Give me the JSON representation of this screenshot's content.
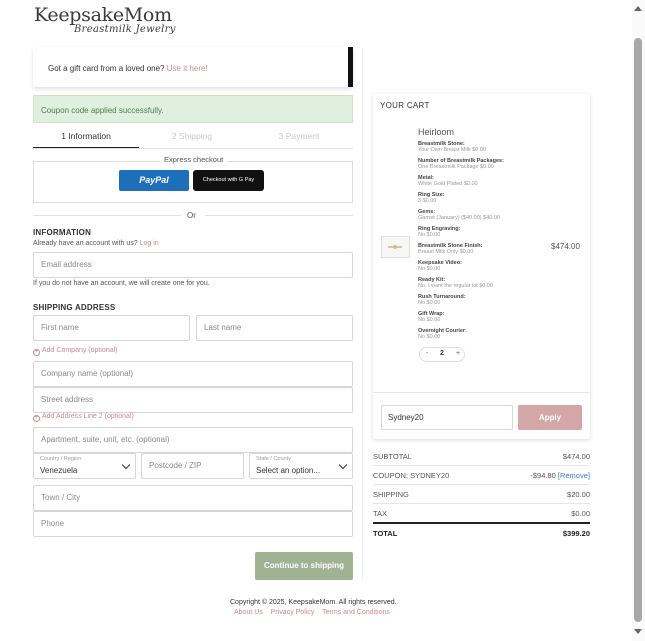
{
  "brand": {
    "name": "KeepsakeMom",
    "tagline": "Breastmilk Jewelry"
  },
  "gift": {
    "prompt": "Got a gift card from a loved one?",
    "link": "Use it here!"
  },
  "alert": {
    "message": "Coupon code applied successfully."
  },
  "steps": [
    {
      "label": "1 Information"
    },
    {
      "label": "2 Shipping"
    },
    {
      "label": "3 Payment"
    }
  ],
  "express": {
    "label": "Express checkout",
    "paypal": "PayPal",
    "gpay": "Checkout with G Pay"
  },
  "or_text": "Or",
  "information": {
    "title": "INFORMATION",
    "account_prompt": "Already have an account with us?",
    "login_link": "Log in",
    "email_placeholder": "Email address",
    "note": "If you do not have an account, we will create one for you."
  },
  "shipping": {
    "title": "SHIPPING ADDRESS",
    "first_name": "First name",
    "last_name": "Last name",
    "add_company": "Add Company (optional)",
    "company": "Company name (optional)",
    "street": "Street address",
    "add_line2": "Add Address Line 2 (optional)",
    "apartment": "Apartment, suite, unit, etc. (optional)",
    "country_label": "Country / Region",
    "country_value": "Venezuela",
    "postcode": "Postcode / ZIP",
    "state_label": "State / County",
    "state_value": "Select an option...",
    "city": "Town / City",
    "phone": "Phone"
  },
  "continue_label": "Continue to shipping",
  "cart": {
    "title": "YOUR CART",
    "product_name": "Heirloom",
    "price": "$474.00",
    "options": [
      {
        "label": "Breastmilk Stone:",
        "value": "Your Own Breast Milk $0.00"
      },
      {
        "label": "Number of Breastmilk Packages:",
        "value": "One Breastmilk Package $0.00"
      },
      {
        "label": "Metal:",
        "value": "White Gold Plated $0.00"
      },
      {
        "label": "Ring Size:",
        "value": "3 $0.00"
      },
      {
        "label": "Gems:",
        "value": "Garnet (January) ($40.00) $40.00"
      },
      {
        "label": "Ring Engraving:",
        "value": "No $0.00"
      },
      {
        "label": "Breastmilk Stone Finish:",
        "value": "Breast Milk Only $0.00"
      },
      {
        "label": "Keepsake Video:",
        "value": "No $0.00"
      },
      {
        "label": "Ready Kit:",
        "value": "No, I want the regular kit $0.00"
      },
      {
        "label": "Rush Turnaround:",
        "value": "No $0.00"
      },
      {
        "label": "Gift Wrap:",
        "value": "No $0.00"
      },
      {
        "label": "Overnight Courier:",
        "value": "No $0.00"
      }
    ],
    "quantity": "2",
    "qty_minus": "-",
    "qty_plus": "+",
    "promo_value": "Sydney20",
    "apply_label": "Apply"
  },
  "summary": {
    "subtotal_label": "SUBTOTAL",
    "subtotal": "$474.00",
    "coupon_label": "COUPON: SYDNEY20",
    "coupon": "-$94.80",
    "remove": "[Remove]",
    "shipping_label": "SHIPPING",
    "shipping": "$20.00",
    "tax_label": "TAX",
    "tax": "$0.00",
    "total_label": "TOTAL",
    "total": "$399.20"
  },
  "footer": {
    "copyright": "Copyright © 2025, KeepsakeMom. All rights reserved.",
    "about": "About Us",
    "privacy": "Privacy Policy",
    "terms": "Terms and Conditions"
  },
  "colors": {
    "accent_pink": "#c98b8b",
    "apply_pink": "#d3a6a7",
    "continue_green": "#9fb394",
    "alert_bg": "#e0f0de",
    "paypal_blue": "#1f6fb8"
  },
  "icons": [
    "plus-circle-icon",
    "chevron-down-icon",
    "product-thumbnail"
  ]
}
